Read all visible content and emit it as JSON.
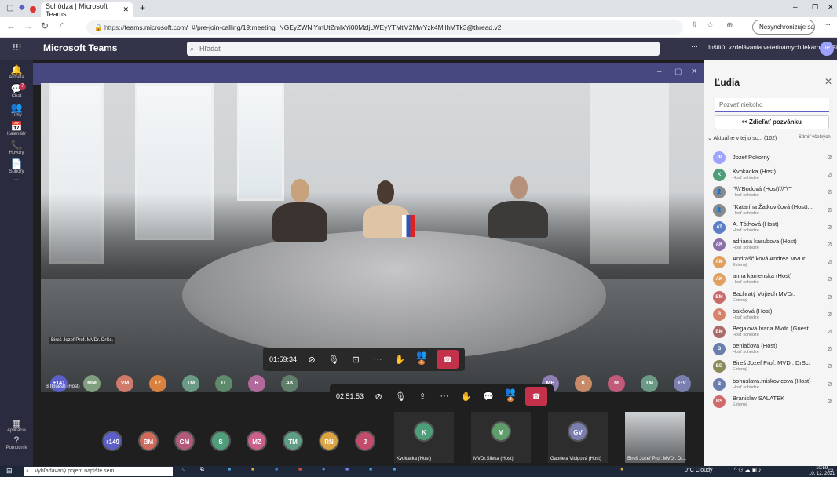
{
  "browser": {
    "tab_title": "Schôdza | Microsoft Teams",
    "new_tab": "+",
    "url_prefix": "https://",
    "url": "teams.microsoft.com/_#/pre-join-calling/19:meeting_NGEyZWNiYmUtZmIxYi00MzljLWEyYTMtM2MwYzk4MjlhMTk3@thread.v2",
    "sync_label": "Nesynchronizuje sa"
  },
  "teams": {
    "app_title": "Microsoft Teams",
    "search_placeholder": "Hľadať",
    "org_name": "Inštitút vzdelávania veterinárnych lekárov Košice",
    "user_initials": "JP",
    "more": "···"
  },
  "rail": [
    {
      "label": "Aktivita",
      "icon": "bell-icon",
      "glyph": "🔔"
    },
    {
      "label": "Chat",
      "icon": "chat-icon",
      "glyph": "💬",
      "badge": "7"
    },
    {
      "label": "Tímy",
      "icon": "teams-icon",
      "glyph": "👥"
    },
    {
      "label": "Kalendár",
      "icon": "calendar-icon",
      "glyph": "📅"
    },
    {
      "label": "Hovory",
      "icon": "phone-icon",
      "glyph": "📞"
    },
    {
      "label": "Súbory",
      "icon": "files-icon",
      "glyph": "📄"
    },
    {
      "label": "···",
      "icon": "more-icon",
      "glyph": ""
    }
  ],
  "rail_bottom": [
    {
      "label": "Aplikácie",
      "icon": "apps-icon",
      "glyph": "▦"
    },
    {
      "label": "Pomocník",
      "icon": "help-icon",
      "glyph": "?"
    }
  ],
  "meeting": {
    "speaker_label": "Bireš Jozef Prof. MVDr. DrSc.",
    "inner_timer": "01:59:34",
    "outer_timer": "02:51:53",
    "inner_participants_badge": "1",
    "outer_participants_badge": "3"
  },
  "inner_strip": [
    {
      "initials": "+141",
      "color": "#5b5fc7",
      "label": "B (Guest) (Host)"
    },
    {
      "initials": "MM",
      "color": "#7f9f7f"
    },
    {
      "initials": "VM",
      "color": "#cf7a6a"
    },
    {
      "initials": "TZ",
      "color": "#d9823f"
    },
    {
      "initials": "TM",
      "color": "#6a9a86"
    },
    {
      "initials": "TL",
      "color": "#5d8a6a"
    },
    {
      "initials": "R",
      "color": "#b06a9c"
    },
    {
      "initials": "AK",
      "color": "#5f7f6a"
    }
  ],
  "inner_strip_right": [
    {
      "initials": "MB",
      "color": "#8e7fb2"
    },
    {
      "initials": "K",
      "color": "#c98a6a"
    },
    {
      "initials": "M",
      "color": "#c25a7a"
    },
    {
      "initials": "TM",
      "color": "#6a9a86"
    },
    {
      "initials": "GV",
      "color": "#7a7fb0"
    }
  ],
  "outer_strip": [
    {
      "initials": "+149",
      "color": "#5b5fc7"
    },
    {
      "initials": "BM",
      "color": "#d06a5a"
    },
    {
      "initials": "GM",
      "color": "#b35a7a"
    },
    {
      "initials": "S",
      "color": "#4f9e7a"
    },
    {
      "initials": "MZ",
      "color": "#c95f8a"
    },
    {
      "initials": "TM",
      "color": "#5f9e86"
    },
    {
      "initials": "RN",
      "color": "#d9a441"
    },
    {
      "initials": "J",
      "color": "#c14d6a"
    }
  ],
  "outer_tiles": [
    {
      "initials": "K",
      "color": "#4f9e7a",
      "label": "Kvokacka (Host)"
    },
    {
      "initials": "M",
      "color": "#5f9e6a",
      "label": "MVDr.Slivka (Host)"
    },
    {
      "initials": "GV",
      "color": "#7a7fb0",
      "label": "Gabriela Vicigová (Host)"
    },
    {
      "initials": "",
      "color": "#4a4a4a",
      "label": "Bireš Jozef Prof. MVDr. Dr..."
    }
  ],
  "people": {
    "title": "Ľudia",
    "invite_placeholder": "Pozvať niekoho",
    "share_label": "Zdieľať pozvánku",
    "in_meeting_label": "Aktuálne v tejto sc...  (162)",
    "mute_all": "Stlmiť všetkých",
    "list": [
      {
        "initials": "JP",
        "color": "#9ea2ff",
        "name": "Jozef Pokorny",
        "sub": ""
      },
      {
        "initials": "K",
        "color": "#4f9e7a",
        "name": "Kvokacka (Host)",
        "sub": "Hosť schôdze"
      },
      {
        "initials": "",
        "color": "#8a8a8a",
        "name": "\"\\\\\\\"Bodová (Host)\\\\\\\"\\\"\"",
        "sub": "Hosť schôdze"
      },
      {
        "initials": "",
        "color": "#8a8a8a",
        "name": "\"Katarína Žatkovičová (Host)...",
        "sub": "Hosť schôdze"
      },
      {
        "initials": "AT",
        "color": "#5b7fc7",
        "name": "A. Tóthová (Host)",
        "sub": "Hosť schôdze"
      },
      {
        "initials": "AK",
        "color": "#8a6fa8",
        "name": "adriana kasubova (Host)",
        "sub": "Hosť schôdze"
      },
      {
        "initials": "AM",
        "color": "#e0a060",
        "name": "Andraščíková Andrea MVDr.",
        "sub": "Externý"
      },
      {
        "initials": "AK",
        "color": "#e0a060",
        "name": "anna kamenska (Host)",
        "sub": "Hosť schôdze"
      },
      {
        "initials": "BM",
        "color": "#c96a6a",
        "name": "Bachratý Vojtech MVDr.",
        "sub": "Externý"
      },
      {
        "initials": "B",
        "color": "#d9826a",
        "name": "bakšová (Host)",
        "sub": "Hosť schôdze"
      },
      {
        "initials": "BM",
        "color": "#a86a6a",
        "name": "Begalová Ivana Mvdr. (Guest...",
        "sub": "Hosť schôdze"
      },
      {
        "initials": "B",
        "color": "#6a7fb0",
        "name": "beniačová (Host)",
        "sub": "Hosť schôdze"
      },
      {
        "initials": "BD",
        "color": "#8a8a5a",
        "name": "Bireš Jozef Prof. MVDr. DrSc.",
        "sub": "Externý"
      },
      {
        "initials": "B",
        "color": "#6a7fb0",
        "name": "bohuslava.miskovicova (Host)",
        "sub": "Hosť schôdze"
      },
      {
        "initials": "BS",
        "color": "#d06a6a",
        "name": "Branislav SALATEK",
        "sub": "Externý"
      }
    ]
  },
  "taskbar": {
    "search_placeholder": "Vyhľadávaný pojem napíšte sem",
    "weather": "0°C  Cloudy",
    "time": "10:59",
    "date": "10. 12. 2021"
  }
}
